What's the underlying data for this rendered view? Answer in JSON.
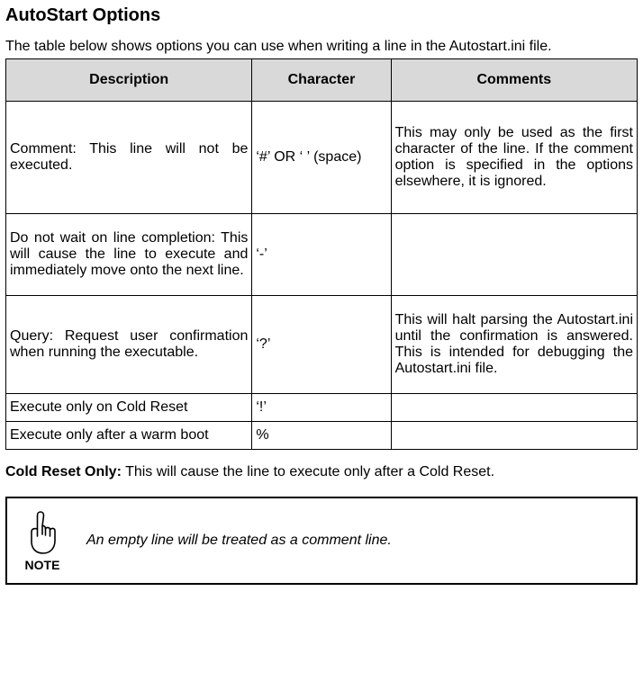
{
  "heading": "AutoStart Options",
  "intro": "The table below shows options you can use when writing a line in the Autostart.ini file.",
  "table": {
    "headers": {
      "c0": "Description",
      "c1": "Character",
      "c2": "Comments"
    },
    "rows": [
      {
        "desc": "Comment: This line will not be executed.",
        "char": "‘#’ OR ‘ ’ (space)",
        "comm": "This may only be used as the first character of the line. If the comment option is specified in the options elsewhere, it is ignored."
      },
      {
        "desc": "Do not wait on line completion: This will cause the line to execute and immediately move onto the next line.",
        "char": "‘-’",
        "comm": ""
      },
      {
        "desc": "Query: Request user confirmation when running the executable.",
        "char": "‘?’",
        "comm": "This will halt parsing the Autostart.ini until the confirmation is answered. This is intended for debugging the Autostart.ini file."
      },
      {
        "desc": "Execute only on Cold Reset",
        "char": "‘!’",
        "comm": ""
      },
      {
        "desc": "Execute only after a warm boot",
        "char": "%",
        "comm": ""
      }
    ]
  },
  "cold_reset_label": "Cold Reset Only:",
  "cold_reset_text": " This will cause the line to execute only after a Cold Reset.",
  "note": {
    "label": "NOTE",
    "text": "An empty line will be treated as a comment line."
  }
}
